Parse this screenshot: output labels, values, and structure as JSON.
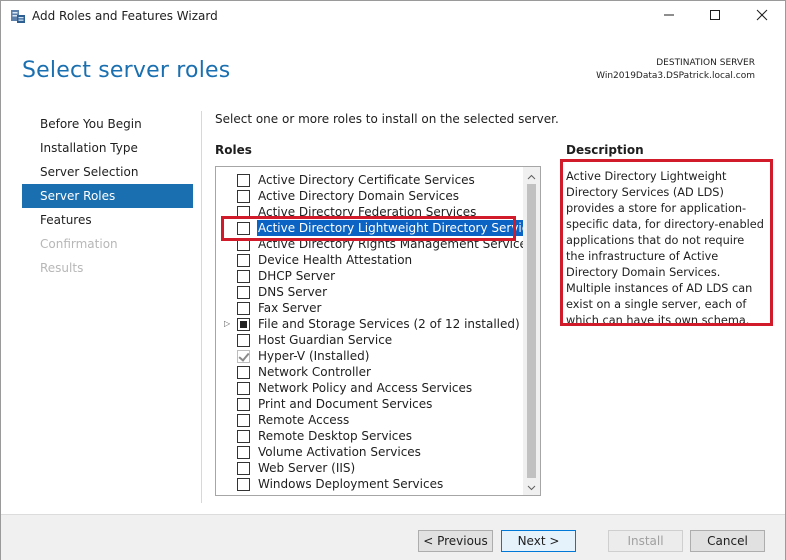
{
  "window": {
    "title": "Add Roles and Features Wizard",
    "controls": {
      "minimize": "minimize-icon",
      "maximize": "maximize-icon",
      "close": "close-icon"
    }
  },
  "header": {
    "title": "Select server roles",
    "destination_label": "DESTINATION SERVER",
    "destination_value": "Win2019Data3.DSPatrick.local.com"
  },
  "nav": {
    "items": [
      {
        "label": "Before You Begin",
        "state": "normal"
      },
      {
        "label": "Installation Type",
        "state": "normal"
      },
      {
        "label": "Server Selection",
        "state": "normal"
      },
      {
        "label": "Server Roles",
        "state": "active"
      },
      {
        "label": "Features",
        "state": "normal"
      },
      {
        "label": "Confirmation",
        "state": "disabled"
      },
      {
        "label": "Results",
        "state": "disabled"
      }
    ]
  },
  "content": {
    "instruction": "Select one or more roles to install on the selected server.",
    "roles_header": "Roles",
    "description_header": "Description",
    "description_text": "Active Directory Lightweight Directory Services (AD LDS) provides a store for application-specific data, for directory-enabled applications that do not require the infrastructure of Active Directory Domain Services. Multiple instances of AD LDS can exist on a single server, each of which can have its own schema.",
    "roles": [
      {
        "label": "Active Directory Certificate Services",
        "state": "unchecked"
      },
      {
        "label": "Active Directory Domain Services",
        "state": "unchecked"
      },
      {
        "label": "Active Directory Federation Services",
        "state": "unchecked"
      },
      {
        "label": "Active Directory Lightweight Directory Services",
        "state": "unchecked",
        "selected": true
      },
      {
        "label": "Active Directory Rights Management Services",
        "state": "unchecked"
      },
      {
        "label": "Device Health Attestation",
        "state": "unchecked"
      },
      {
        "label": "DHCP Server",
        "state": "unchecked"
      },
      {
        "label": "DNS Server",
        "state": "unchecked"
      },
      {
        "label": "Fax Server",
        "state": "unchecked"
      },
      {
        "label": "File and Storage Services (2 of 12 installed)",
        "state": "partial",
        "expandable": true
      },
      {
        "label": "Host Guardian Service",
        "state": "unchecked"
      },
      {
        "label": "Hyper-V (Installed)",
        "state": "checked-disabled"
      },
      {
        "label": "Network Controller",
        "state": "unchecked"
      },
      {
        "label": "Network Policy and Access Services",
        "state": "unchecked"
      },
      {
        "label": "Print and Document Services",
        "state": "unchecked"
      },
      {
        "label": "Remote Access",
        "state": "unchecked"
      },
      {
        "label": "Remote Desktop Services",
        "state": "unchecked"
      },
      {
        "label": "Volume Activation Services",
        "state": "unchecked"
      },
      {
        "label": "Web Server (IIS)",
        "state": "unchecked"
      },
      {
        "label": "Windows Deployment Services",
        "state": "unchecked"
      }
    ]
  },
  "footer": {
    "previous": "< Previous",
    "next": "Next >",
    "install": "Install",
    "cancel": "Cancel"
  },
  "colors": {
    "accent": "#1a6fb0",
    "selection": "#0b63c4",
    "annotation": "#d11a2a"
  }
}
